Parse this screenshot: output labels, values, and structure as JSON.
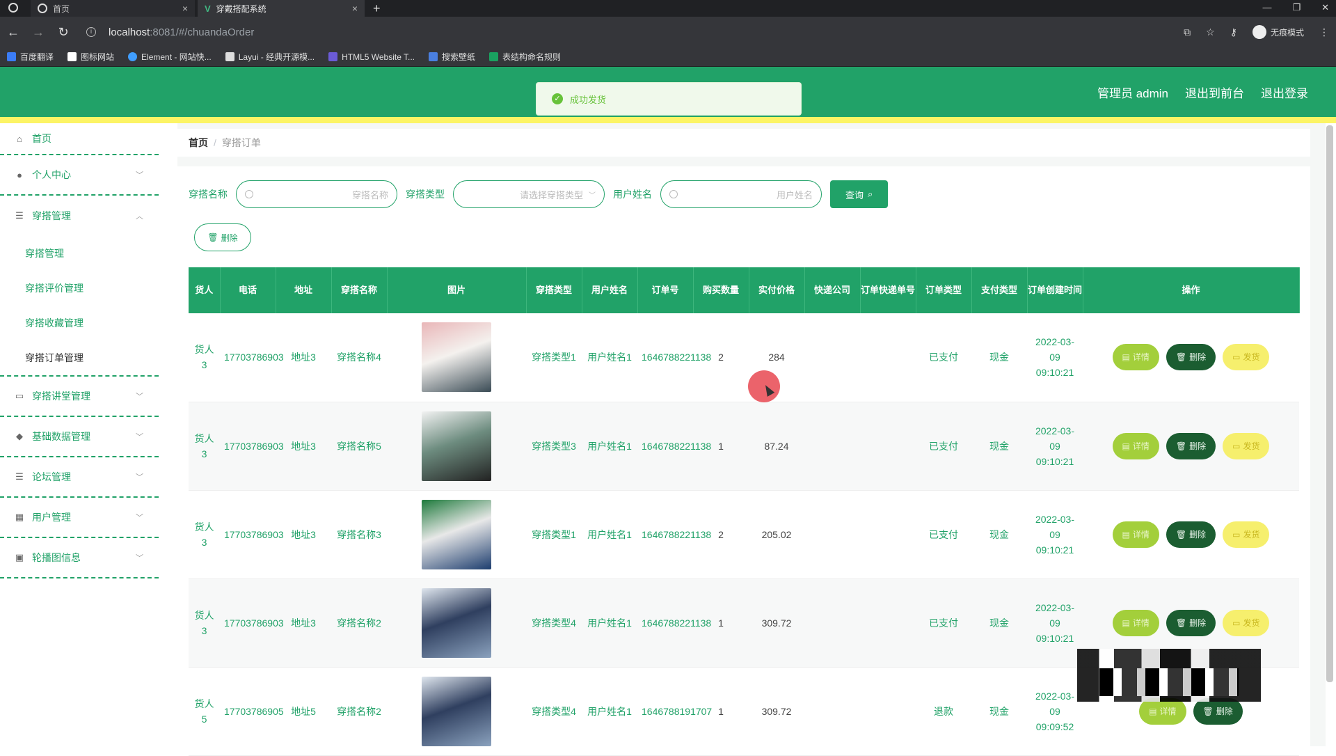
{
  "browser": {
    "tabs": [
      {
        "label": "首页"
      },
      {
        "label": "穿戴搭配系统"
      }
    ],
    "url_host": "localhost",
    "url_rest": ":8081/#/chuandaOrder",
    "incognito_label": "无痕模式",
    "bookmarks": [
      {
        "label": "百度翻译",
        "color": "#3b7cf6"
      },
      {
        "label": "图标网站",
        "color": "#ffffff"
      },
      {
        "label": "Element - 网站快...",
        "color": "#409eff"
      },
      {
        "label": "Layui - 经典开源模...",
        "color": "#dddddd"
      },
      {
        "label": "HTML5 Website T...",
        "color": "#6b5bd6"
      },
      {
        "label": "搜索壁纸",
        "color": "#4a7fe0"
      },
      {
        "label": "表结构命名规则",
        "color": "#1aa260"
      }
    ]
  },
  "header": {
    "admin_label": "管理员 admin",
    "to_front_label": "退出到前台",
    "logout_label": "退出登录"
  },
  "toast": {
    "message": "成功发货"
  },
  "sidebar": {
    "home": "首页",
    "personal": "个人中心",
    "outfit_group": "穿搭管理",
    "outfit_subitems": [
      "穿搭管理",
      "穿搭评价管理",
      "穿搭收藏管理",
      "穿搭订单管理"
    ],
    "lecture": "穿搭讲堂管理",
    "basedata": "基础数据管理",
    "forum": "论坛管理",
    "users": "用户管理",
    "banner": "轮播图信息"
  },
  "breadcrumb": {
    "home": "首页",
    "sep": "/",
    "current": "穿搭订单"
  },
  "search": {
    "name_label": "穿搭名称",
    "name_placeholder": "穿搭名称",
    "type_label": "穿搭类型",
    "type_placeholder": "请选择穿搭类型",
    "user_label": "用户姓名",
    "user_placeholder": "用户姓名",
    "query_label": "查询"
  },
  "bulk_delete_label": "删除",
  "table": {
    "headers": [
      "货人",
      "电话",
      "地址",
      "穿搭名称",
      "图片",
      "穿搭类型",
      "用户姓名",
      "订单号",
      "购买数量",
      "实付价格",
      "快递公司",
      "订单快递单号",
      "订单类型",
      "支付类型",
      "订单创建时间",
      "操作"
    ],
    "op_detail": "详情",
    "op_delete": "删除",
    "op_ship": "发货",
    "rows": [
      {
        "receiver": "货人3",
        "phone": "17703786903",
        "address": "地址3",
        "name": "穿搭名称4",
        "type": "穿搭类型1",
        "user": "用户姓名1",
        "order_no": "1646788221138",
        "qty": "2",
        "price": "284",
        "courier": "",
        "tracking": "",
        "order_type": "已支付",
        "pay_type": "现金",
        "created": "2022-03-09 09:10:21",
        "img_colors": [
          "#e9b6b8",
          "#f4f1ee",
          "#3a4b55"
        ],
        "show_ship": true
      },
      {
        "receiver": "货人3",
        "phone": "17703786903",
        "address": "地址3",
        "name": "穿搭名称5",
        "type": "穿搭类型3",
        "user": "用户姓名1",
        "order_no": "1646788221138",
        "qty": "1",
        "price": "87.24",
        "courier": "",
        "tracking": "",
        "order_type": "已支付",
        "pay_type": "现金",
        "created": "2022-03-09 09:10:21",
        "img_colors": [
          "#f2f2f2",
          "#6d8c7f",
          "#222222"
        ],
        "show_ship": true
      },
      {
        "receiver": "货人3",
        "phone": "17703786903",
        "address": "地址3",
        "name": "穿搭名称3",
        "type": "穿搭类型1",
        "user": "用户姓名1",
        "order_no": "1646788221138",
        "qty": "2",
        "price": "205.02",
        "courier": "",
        "tracking": "",
        "order_type": "已支付",
        "pay_type": "现金",
        "created": "2022-03-09 09:10:21",
        "img_colors": [
          "#1e7a3c",
          "#e8e8e8",
          "#1d3d6e"
        ],
        "show_ship": true
      },
      {
        "receiver": "货人3",
        "phone": "17703786903",
        "address": "地址3",
        "name": "穿搭名称2",
        "type": "穿搭类型4",
        "user": "用户姓名1",
        "order_no": "1646788221138",
        "qty": "1",
        "price": "309.72",
        "courier": "",
        "tracking": "",
        "order_type": "已支付",
        "pay_type": "现金",
        "created": "2022-03-09 09:10:21",
        "img_colors": [
          "#dfe6ee",
          "#2f3f5f",
          "#8aa1bd"
        ],
        "show_ship": true
      },
      {
        "receiver": "货人5",
        "phone": "17703786905",
        "address": "地址5",
        "name": "穿搭名称2",
        "type": "穿搭类型4",
        "user": "用户姓名1",
        "order_no": "1646788191707",
        "qty": "1",
        "price": "309.72",
        "courier": "",
        "tracking": "",
        "order_type": "退款",
        "pay_type": "现金",
        "created": "2022-03-09 09:09:52",
        "img_colors": [
          "#dfe6ee",
          "#2f3f5f",
          "#8aa1bd"
        ],
        "show_ship": false
      }
    ]
  },
  "colors": {
    "brand": "#21a268",
    "stripe": "#fcf465",
    "detail": "#a3cf3b",
    "delete": "#1b5d31",
    "ship": "#f6ef6d"
  }
}
